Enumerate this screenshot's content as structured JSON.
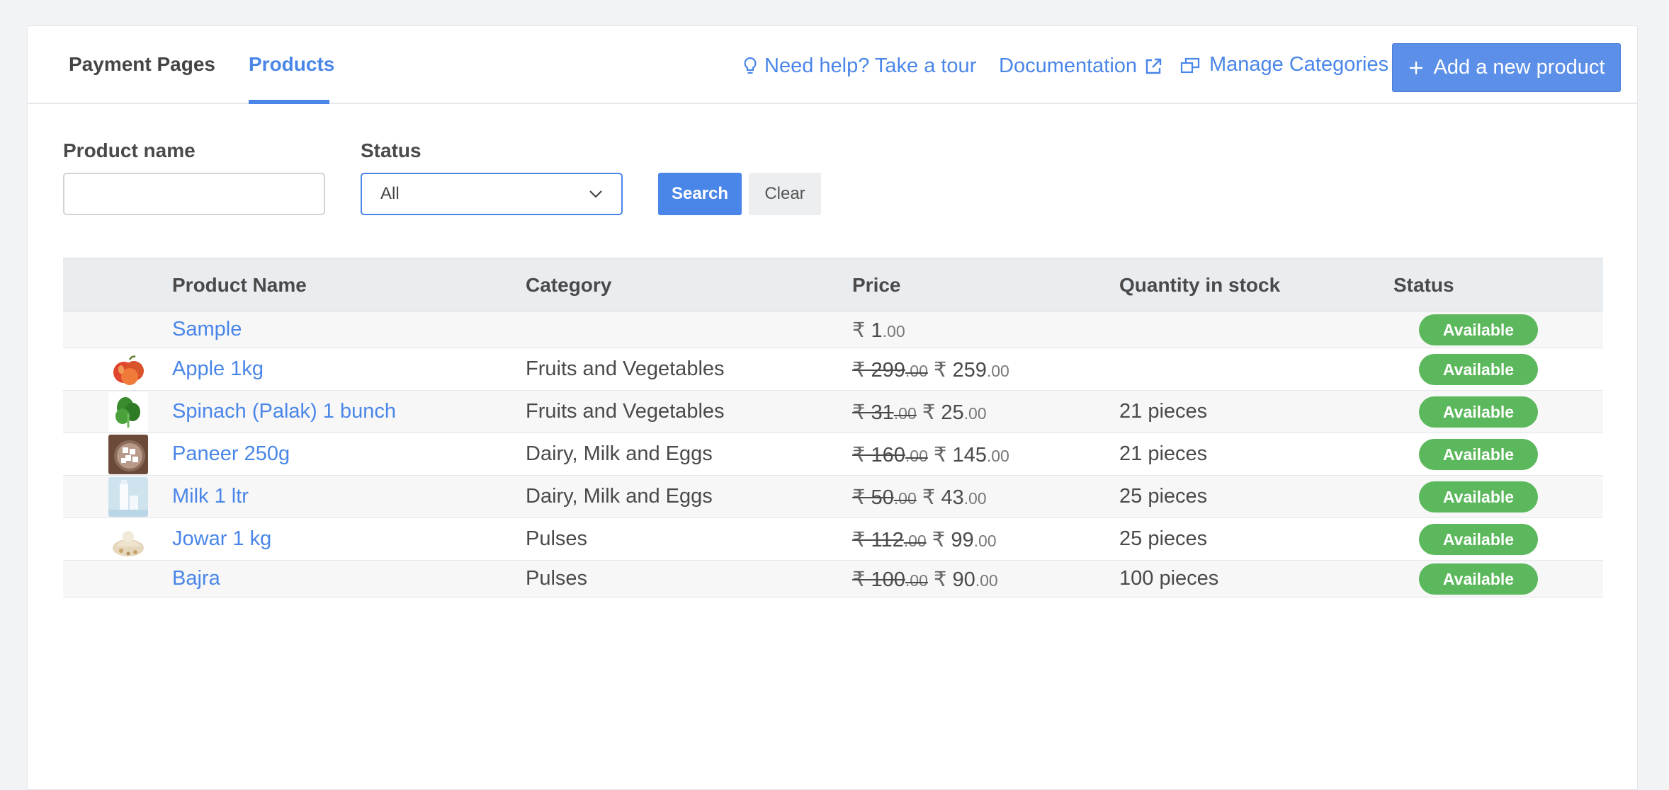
{
  "tabs": [
    {
      "label": "Payment Pages",
      "active": false
    },
    {
      "label": "Products",
      "active": true
    }
  ],
  "header_links": {
    "tour": "Need help? Take a tour",
    "docs": "Documentation",
    "categories": "Manage Categories",
    "add_product": "Add a new product"
  },
  "filters": {
    "product_name_label": "Product name",
    "product_name_value": "",
    "status_label": "Status",
    "status_value": "All",
    "search_label": "Search",
    "clear_label": "Clear"
  },
  "table": {
    "columns": [
      "Product Name",
      "Category",
      "Price",
      "Quantity in stock",
      "Status"
    ],
    "rows": [
      {
        "name": "Sample",
        "category": "",
        "mrp_int": "",
        "mrp_dec": "",
        "price_int": "1",
        "price_dec": ".00",
        "qty": "",
        "status": "Available",
        "thumb": "none"
      },
      {
        "name": "Apple 1kg",
        "category": "Fruits and Vegetables",
        "mrp_int": "299",
        "mrp_dec": ".00",
        "price_int": "259",
        "price_dec": ".00",
        "qty": "",
        "status": "Available",
        "thumb": "apple"
      },
      {
        "name": "Spinach (Palak) 1 bunch",
        "category": "Fruits and Vegetables",
        "mrp_int": "31",
        "mrp_dec": ".00",
        "price_int": "25",
        "price_dec": ".00",
        "qty": "21 pieces",
        "status": "Available",
        "thumb": "spinach"
      },
      {
        "name": "Paneer 250g",
        "category": "Dairy, Milk and Eggs",
        "mrp_int": "160",
        "mrp_dec": ".00",
        "price_int": "145",
        "price_dec": ".00",
        "qty": "21 pieces",
        "status": "Available",
        "thumb": "paneer"
      },
      {
        "name": "Milk 1 ltr",
        "category": "Dairy, Milk and Eggs",
        "mrp_int": "50",
        "mrp_dec": ".00",
        "price_int": "43",
        "price_dec": ".00",
        "qty": "25 pieces",
        "status": "Available",
        "thumb": "milk"
      },
      {
        "name": "Jowar 1 kg",
        "category": "Pulses",
        "mrp_int": "112",
        "mrp_dec": ".00",
        "price_int": "99",
        "price_dec": ".00",
        "qty": "25 pieces",
        "status": "Available",
        "thumb": "jowar"
      },
      {
        "name": "Bajra",
        "category": "Pulses",
        "mrp_int": "100",
        "mrp_dec": ".00",
        "price_int": "90",
        "price_dec": ".00",
        "qty": "100 pieces",
        "status": "Available",
        "thumb": "none"
      }
    ]
  },
  "currency_symbol": "₹",
  "colors": {
    "accent": "#4a86e8",
    "status_available": "#5cb85c"
  }
}
